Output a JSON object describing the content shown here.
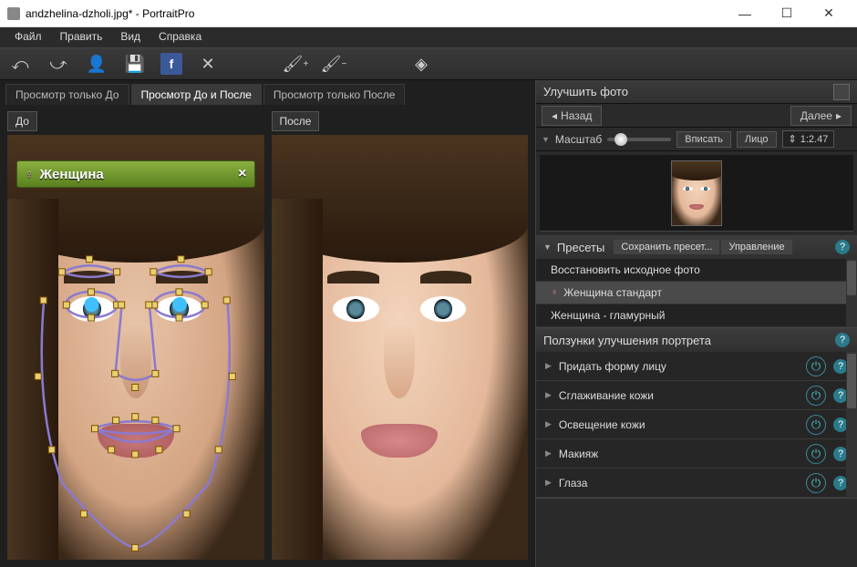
{
  "window": {
    "title": "andzhelina-dzholi.jpg* - PortraitPro"
  },
  "menu": {
    "file": "Файл",
    "edit": "Править",
    "view": "Вид",
    "help": "Справка"
  },
  "viewtabs": {
    "before_only": "Просмотр только До",
    "before_after": "Просмотр До и После",
    "after_only": "Просмотр только После"
  },
  "labels": {
    "before": "До",
    "after": "После"
  },
  "gender_badge": {
    "text": "Женщина",
    "close": "×"
  },
  "panel": {
    "title": "Улучшить фото",
    "back": "Назад",
    "next": "Далее",
    "scale_label": "Масштаб",
    "fit": "Вписать",
    "face": "Лицо",
    "ratio": "1:2.47"
  },
  "presets": {
    "header": "Пресеты",
    "save": "Сохранить пресет...",
    "manage": "Управление",
    "items": [
      "Восстановить исходное фото",
      "Женщина стандарт",
      "Женщина - гламурный"
    ]
  },
  "sliders": {
    "header": "Ползунки улучшения портрета",
    "items": [
      "Придать форму лицу",
      "Сглаживание кожи",
      "Освещение кожи",
      "Макияж",
      "Глаза"
    ]
  },
  "help_glyph": "?",
  "power_glyph": "⏻",
  "arrow_glyph": "◁"
}
